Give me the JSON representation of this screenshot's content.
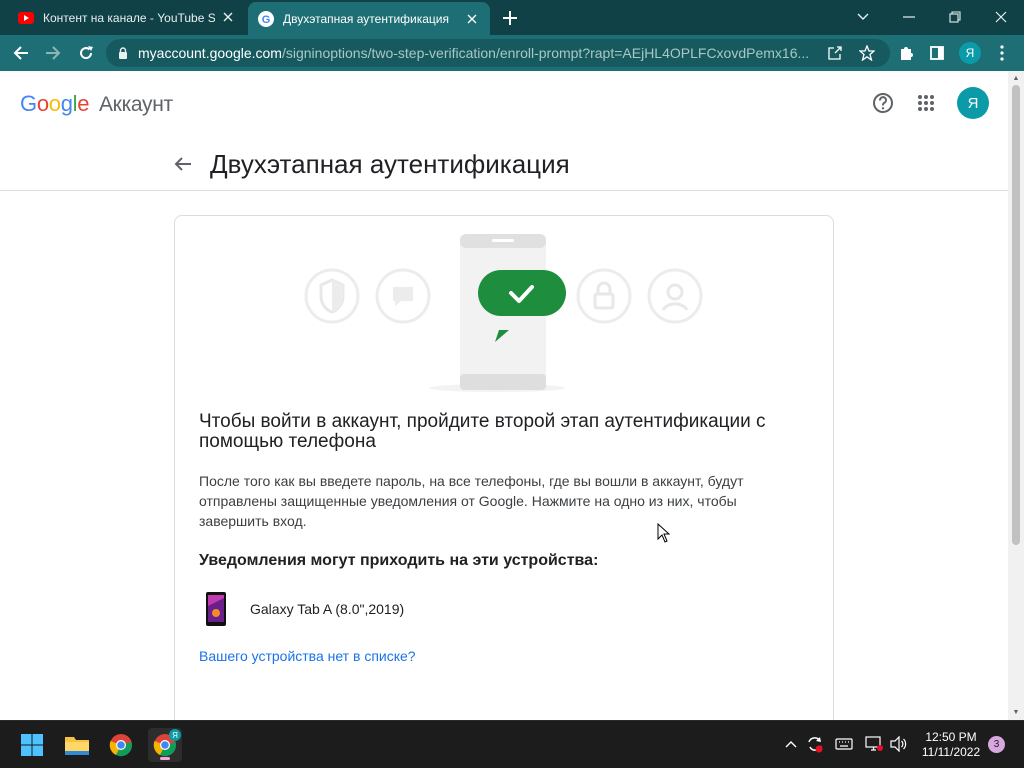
{
  "browser": {
    "tabs": [
      {
        "title": "Контент на канале - YouTube Studio",
        "favicon": "youtube-icon",
        "active": false
      },
      {
        "title": "Двухэтапная аутентификация",
        "favicon": "google-icon",
        "active": true
      }
    ],
    "address": {
      "host": "myaccount.google.com",
      "path": "/signinoptions/two-step-verification/enroll-prompt?rapt=AEjHL4OPLFCxovdPemx16..."
    },
    "profile_initial": "Я"
  },
  "header": {
    "logo_letters": [
      "G",
      "o",
      "o",
      "g",
      "l",
      "e"
    ],
    "product": "Аккаунт",
    "avatar_initial": "Я"
  },
  "page": {
    "title": "Двухэтапная аутентификация"
  },
  "card": {
    "heading": "Чтобы войти в аккаунт, пройдите второй этап аутентификации с помощью телефона",
    "description": "После того как вы введете пароль, на все телефоны, где вы вошли в аккаунт, будут отправлены защищенные уведомления от Google. Нажмите на одно из них, чтобы завершить вход.",
    "devices_heading": "Уведомления могут приходить на эти устройства:",
    "devices": [
      {
        "name": "Galaxy Tab A (8.0\",2019)"
      }
    ],
    "missing_device_link": "Вашего устройства нет в списке?"
  },
  "taskbar": {
    "time": "12:50 PM",
    "date": "11/11/2022",
    "notifications": "3",
    "chrome_profile_badge": "Я"
  },
  "colors": {
    "chrome_dark": "#0f4146",
    "chrome_teal": "#1e6f75",
    "link_blue": "#1a73e8",
    "avatar_teal": "#0b9aa8",
    "check_green": "#1e8e3e"
  }
}
